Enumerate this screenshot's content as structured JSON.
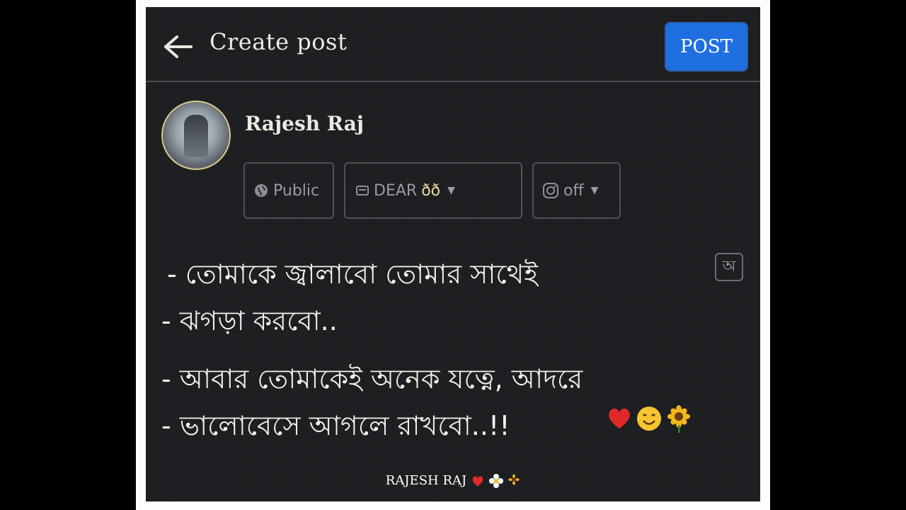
{
  "header": {
    "title": "Create post",
    "post_label": "POST"
  },
  "profile": {
    "name": "Rajesh Raj"
  },
  "audience": {
    "public_label": "Public",
    "album_label": "DEAR",
    "album_suffix": "ðð",
    "instagram_label": "off"
  },
  "post": {
    "lines": [
      "- তোমাকে জ্বালাবো তোমার সাথেই",
      "- ঝগড়া করবো..",
      "- আবার তোমাকেই অনেক যত্নে, আদরে",
      "- ভালোবেসে আগলে রাখবো..!!"
    ],
    "translate_glyph": "অ"
  },
  "footer": {
    "signature": "RAJESH RAJ"
  },
  "colors": {
    "background": "#1c1d20",
    "accent": "#1f6fe0",
    "text": "#f3f1ea",
    "muted": "#9a9b9f"
  }
}
